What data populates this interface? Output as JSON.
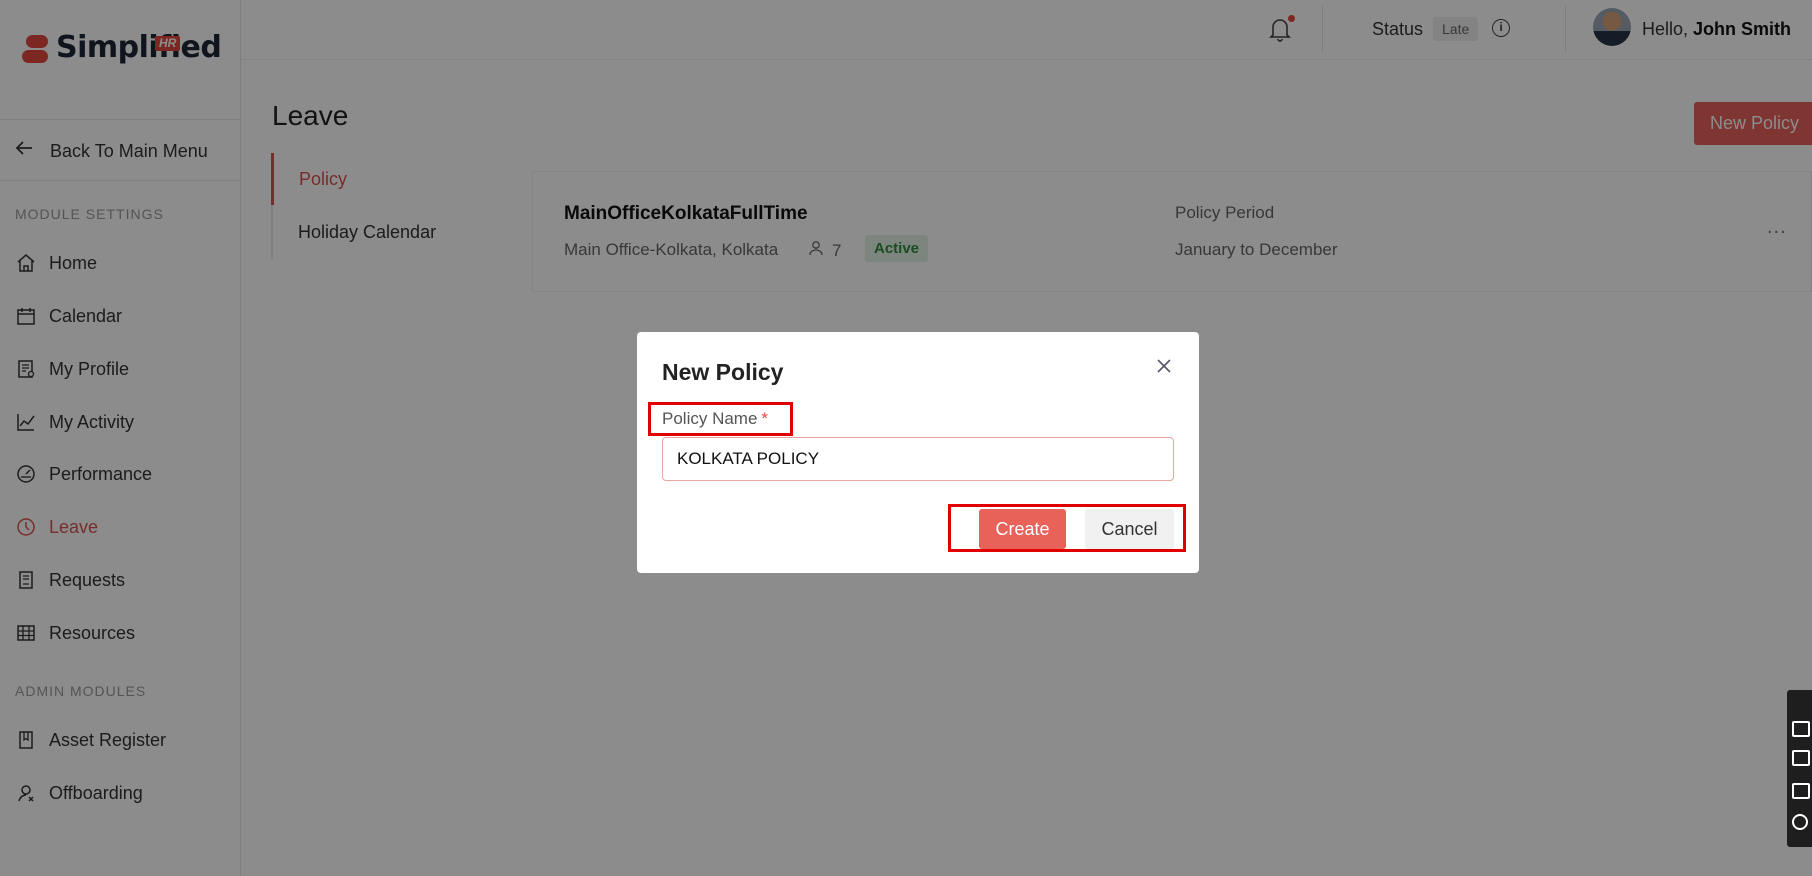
{
  "app": {
    "logo_text": "Simplified",
    "logo_badge": "HR"
  },
  "sidebar": {
    "back_label": "Back To Main Menu",
    "module_settings_label": "MODULE SETTINGS",
    "admin_modules_label": "ADMIN MODULES",
    "items": [
      {
        "label": "Home",
        "icon": "home-icon"
      },
      {
        "label": "Calendar",
        "icon": "calendar-icon"
      },
      {
        "label": "My Profile",
        "icon": "profile-icon"
      },
      {
        "label": "My Activity",
        "icon": "activity-icon"
      },
      {
        "label": "Performance",
        "icon": "gauge-icon"
      },
      {
        "label": "Leave",
        "icon": "clock-icon",
        "active": true
      },
      {
        "label": "Requests",
        "icon": "requests-icon"
      },
      {
        "label": "Resources",
        "icon": "table-icon"
      }
    ],
    "admin_items": [
      {
        "label": "Asset Register",
        "icon": "book-icon"
      },
      {
        "label": "Offboarding",
        "icon": "offboarding-icon"
      }
    ]
  },
  "header": {
    "status_label": "Status",
    "status_value": "Late",
    "greeting": "Hello,",
    "user_name": "John Smith"
  },
  "main": {
    "title": "Leave",
    "new_policy_button": "New Policy",
    "subnav": [
      "Policy",
      "Holiday Calendar"
    ],
    "policy_card": {
      "name": "MainOfficeKolkataFullTime",
      "location": "Main Office-Kolkata, Kolkata",
      "user_count": "7",
      "status": "Active",
      "period_label": "Policy Period",
      "period_value": "January to December",
      "more": "..."
    }
  },
  "modal": {
    "title": "New Policy",
    "field_label": "Policy Name",
    "required_mark": "*",
    "field_value": "KOLKATA POLICY",
    "create_label": "Create",
    "cancel_label": "Cancel"
  },
  "colors": {
    "accent": "#e8625a",
    "active_text": "#d9534f",
    "highlight_box": "#e00000"
  }
}
